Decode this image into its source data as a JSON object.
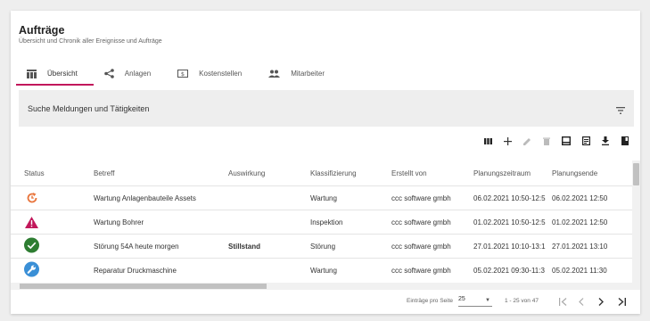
{
  "header": {
    "title": "Aufträge",
    "subtitle": "Übersicht und Chronik aller Ereignisse und Aufträge"
  },
  "tabs": [
    {
      "label": "Übersicht",
      "icon": "table-view-icon",
      "active": true
    },
    {
      "label": "Anlagen",
      "icon": "share-icon",
      "active": false
    },
    {
      "label": "Kostenstellen",
      "icon": "cost-center-icon",
      "active": false
    },
    {
      "label": "Mitarbeiter",
      "icon": "people-icon",
      "active": false
    }
  ],
  "search": {
    "label": "Suche Meldungen und Tätigkeiten",
    "filter_icon": "filter-icon"
  },
  "toolbar": {
    "icons": [
      "columns-icon",
      "add-icon",
      "edit-icon",
      "delete-icon",
      "inbox-icon",
      "calendar-view-icon",
      "download-icon",
      "bookmark-icon"
    ]
  },
  "table": {
    "columns": [
      "Status",
      "Betreff",
      "Auswirkung",
      "Klassifizierung",
      "Erstellt von",
      "Planungszeitraum",
      "Planungsende"
    ],
    "rows": [
      {
        "status": "restart-icon",
        "betreff": "Wartung Anlagenbauteile Assets",
        "auswirkung": "",
        "klassifizierung": "Wartung",
        "erstellt_von": "ccc software gmbh",
        "planungszeitraum": "06.02.2021 10:50-12:5",
        "planungsende": "06.02.2021 12:50"
      },
      {
        "status": "warning-icon",
        "betreff": "Wartung Bohrer",
        "auswirkung": "",
        "klassifizierung": "Inspektion",
        "erstellt_von": "ccc software gmbh",
        "planungszeitraum": "01.02.2021 10:50-12:5",
        "planungsende": "01.02.2021 12:50"
      },
      {
        "status": "check-circle-icon",
        "betreff": "Störung 54A heute morgen",
        "auswirkung": "Stillstand",
        "klassifizierung": "Störung",
        "erstellt_von": "ccc software gmbh",
        "planungszeitraum": "27.01.2021 10:10-13:1",
        "planungsende": "27.01.2021 13:10"
      },
      {
        "status": "wrench-circle-icon",
        "betreff": "Reparatur Druckmaschine",
        "auswirkung": "",
        "klassifizierung": "Wartung",
        "erstellt_von": "ccc software gmbh",
        "planungszeitraum": "05.02.2021 09:30-11:3",
        "planungsende": "05.02.2021 11:30"
      }
    ]
  },
  "pagination": {
    "per_page_label": "Einträge pro Seite",
    "per_page_value": "25",
    "range": "1 - 25 von 47"
  },
  "colors": {
    "accent": "#c2185b",
    "restart": "#e8743b",
    "warning": "#c2185b",
    "check": "#2e7d32",
    "wrench": "#3a8fd6"
  }
}
